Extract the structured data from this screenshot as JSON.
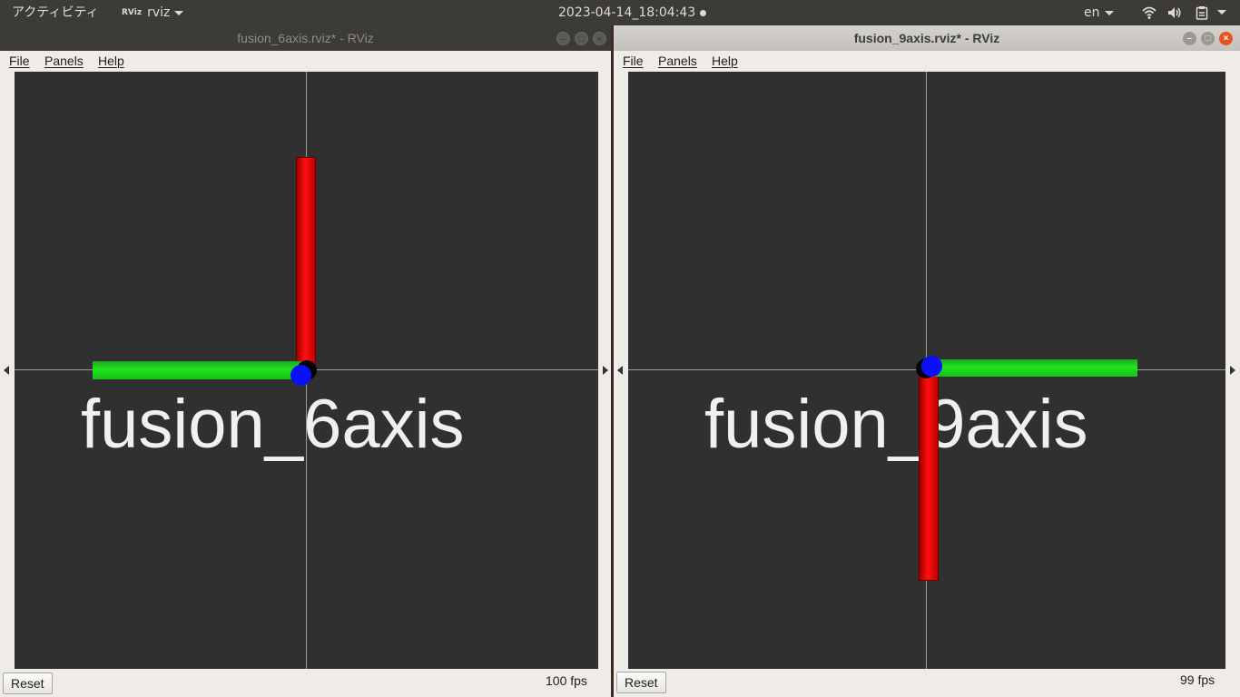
{
  "topbar": {
    "activities": "アクティビティ",
    "app_icon": "RViz",
    "app_name": "rviz",
    "clock": "2023-04-14_18:04:43",
    "lang": "en"
  },
  "windows": [
    {
      "title": "fusion_6axis.rviz* - RViz",
      "menu": [
        "File",
        "Panels",
        "Help"
      ],
      "label": "fusion_6axis",
      "reset": "Reset",
      "fps": "100 fps"
    },
    {
      "title": "fusion_9axis.rviz* - RViz",
      "menu": [
        "File",
        "Panels",
        "Help"
      ],
      "label": "fusion_9axis",
      "reset": "Reset",
      "fps": "99 fps"
    }
  ],
  "colors": {
    "x_axis": "#ff0000",
    "y_axis": "#00ff00",
    "z_axis": "#0000ff",
    "background": "#303030"
  },
  "icons": {
    "wifi": "wifi-icon",
    "volume": "volume-icon",
    "clipboard": "clipboard-icon"
  }
}
